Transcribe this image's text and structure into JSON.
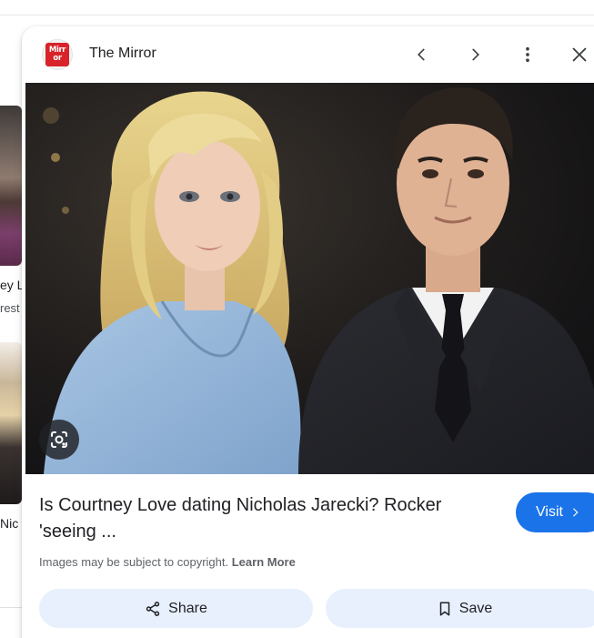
{
  "background_results": {
    "item1": {
      "title_fragment": "ey L",
      "source_fragment": "rest"
    },
    "item2": {
      "title_fragment": "Nic"
    }
  },
  "panel": {
    "source_name": "The Mirror",
    "favicon_text": [
      "Mirr",
      "or"
    ],
    "icons": {
      "prev": "chevron-left-icon",
      "next": "chevron-right-icon",
      "more": "more-vert-icon",
      "close": "close-icon",
      "lens": "google-lens-icon",
      "share": "share-icon",
      "save": "bookmark-icon"
    },
    "result_title": "Is Courtney Love dating Nicholas Jarecki? Rocker 'seeing ...",
    "visit_label": "Visit",
    "copyright_text": "Images may be subject to copyright.",
    "learn_more": "Learn More",
    "share_label": "Share",
    "save_label": "Save"
  },
  "colors": {
    "accent": "#1a73e8",
    "action_bg": "#e8f0fe",
    "brand_red": "#d8232a"
  }
}
